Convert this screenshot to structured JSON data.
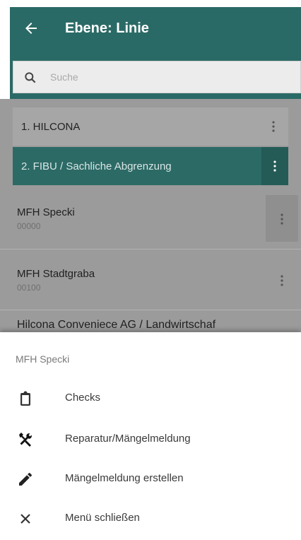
{
  "header": {
    "title": "Ebene: Linie",
    "back_icon": "arrow-back-icon",
    "background": "#2a6a66"
  },
  "search": {
    "placeholder": "Suche",
    "icon": "search-icon"
  },
  "breadcrumbs": [
    {
      "label": "1. HILCONA",
      "icon": "more-vert-icon"
    },
    {
      "label": "2. FIBU / Sachliche Abgrenzung",
      "icon": "more-vert-icon",
      "active": true
    }
  ],
  "list": {
    "items": [
      {
        "title": "MFH Specki",
        "code": "00000",
        "icon": "more-vert-icon"
      },
      {
        "title": "MFH Stadtgraba",
        "code": "00100",
        "icon": "more-vert-icon"
      },
      {
        "title": "Hilcona Conveniece AG / Landwirtschaf"
      }
    ]
  },
  "sheet": {
    "title": "MFH Specki",
    "items": [
      {
        "label": "Checks",
        "icon": "clipboard-icon"
      },
      {
        "label": "Reparatur/Mängelmeldung",
        "icon": "tools-icon"
      },
      {
        "label": "Mängelmeldung erstellen",
        "icon": "pencil-icon"
      },
      {
        "label": "Menü schließen",
        "icon": "close-icon"
      }
    ]
  },
  "colors": {
    "primary": "#2a6a66",
    "active_crumb": "#2c6a66",
    "overlay_list": "#9b9b9b"
  }
}
